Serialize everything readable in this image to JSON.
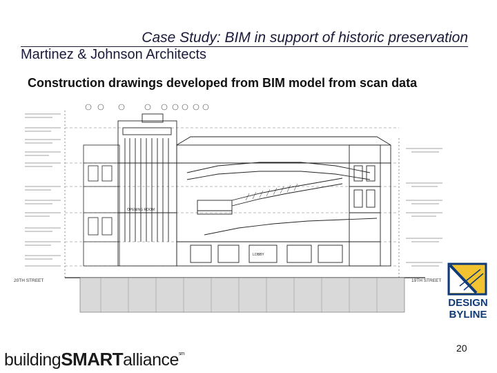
{
  "slide": {
    "title": "Case Study: BIM in support of historic preservation",
    "subtitle": "Martinez & Johnson Architects",
    "caption": "Construction drawings developed from BIM model from scan data",
    "page_number": "20"
  },
  "logos": {
    "bsa": {
      "part1": "building",
      "part2": "SMART",
      "part3": "alliance",
      "mark": "sm"
    },
    "design_byline": {
      "line1": "DESIGN",
      "line2": "BYLINE",
      "colors": {
        "blue": "#0f3a78",
        "yellow": "#f2c230"
      }
    }
  },
  "drawing": {
    "street_left": "20TH STREET",
    "street_right": "19TH STREET",
    "label_room": "OPENING ROOM",
    "label_lobby": "LOBBY"
  }
}
